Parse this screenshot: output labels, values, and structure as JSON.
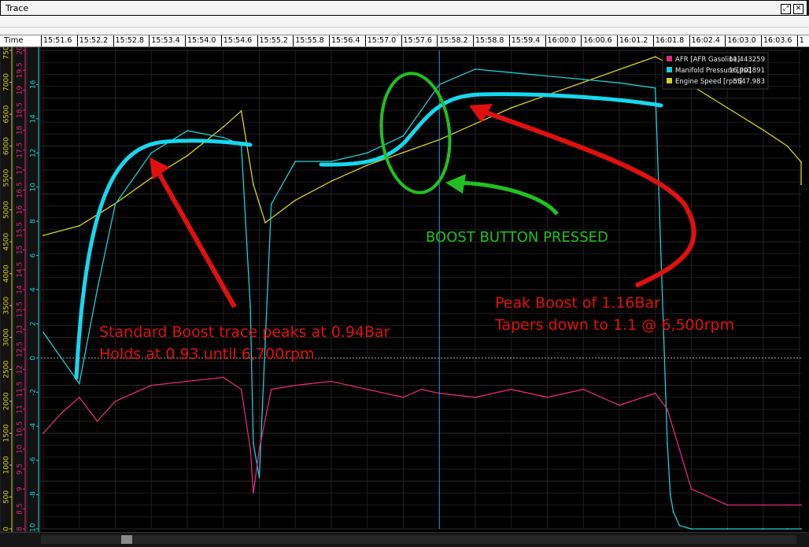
{
  "window": {
    "title": "Trace"
  },
  "time_axis": {
    "label": "Time",
    "ticks": [
      "15:51.6",
      "15:52.2",
      "15:52.8",
      "15:53.4",
      "15:54.0",
      "15:54.6",
      "15:55.2",
      "15:55.8",
      "15:56.4",
      "15:57.0",
      "15:57.6",
      "15:58.2",
      "15:58.8",
      "15:59.4",
      "16:00.0",
      "16:00.6",
      "16:01.2",
      "16:01.8",
      "16:02.4",
      "16:03.0",
      "16:03.6",
      "1"
    ]
  },
  "colors": {
    "afr": "#e0287a",
    "map": "#1ad0d8",
    "rpm": "#d8d01a",
    "cursor": "#2c8fe0",
    "annot_red": "#e01010",
    "annot_green": "#20c020",
    "annot_cyan": "#16d8ee"
  },
  "chart_data": {
    "type": "line",
    "x_range": [
      51.3,
      125.3
    ],
    "x_unit": "seconds past 15:51",
    "cursor_time": "15:58.2",
    "legend": [
      {
        "name": "AFR [AFR Gasoline]",
        "value": "11.443259",
        "color": "#e0287a"
      },
      {
        "name": "Manifold Pressure [psi]",
        "value": "16.901891",
        "color": "#1ad0d8"
      },
      {
        "name": "Engine Speed [rpm]",
        "value": "5547.983",
        "color": "#d8d01a"
      }
    ],
    "axes": [
      {
        "name": "Engine Speed",
        "unit": "rpm",
        "min": 0,
        "max": 7500,
        "ticks": [
          "7500",
          "7000",
          "6500",
          "6000",
          "5500",
          "5000",
          "4500",
          "4000",
          "3500",
          "3000",
          "2500",
          "2000",
          "1500",
          "1000",
          "500",
          "0"
        ]
      },
      {
        "name": "Manifold Pressure",
        "unit": "psi",
        "min": -10,
        "max": 18,
        "ticks": [
          "16",
          "14",
          "12",
          "10",
          "8",
          "6",
          "4",
          "2",
          "0",
          "-2",
          "-4",
          "-6",
          "-8",
          "-10"
        ]
      },
      {
        "name": "AFR",
        "unit": "AFR",
        "min": 8,
        "max": 20,
        "ticks": [
          "20",
          "19.5",
          "19",
          "18.5",
          "18",
          "17.5",
          "17",
          "16.5",
          "16",
          "15.5",
          "15",
          "14.5",
          "14",
          "13.5",
          "13",
          "12.5",
          "12",
          "11.5",
          "11",
          "10.5",
          "10",
          "9.5",
          "9",
          "8.5",
          "8"
        ]
      }
    ],
    "series": [
      {
        "name": "Engine Speed [rpm]",
        "x": [
          51.6,
          52.2,
          52.8,
          53.4,
          54.0,
          54.6,
          54.9,
          55.1,
          55.3,
          55.8,
          56.4,
          57.0,
          57.6,
          58.2,
          58.8,
          59.4,
          60.0,
          60.6,
          61.2,
          61.8,
          62.0,
          62.4,
          63.0,
          63.6,
          64.0,
          64.4,
          65.0
        ],
        "y": [
          4600,
          4750,
          5100,
          5500,
          5850,
          6300,
          6550,
          5400,
          4800,
          5150,
          5450,
          5700,
          5900,
          6100,
          6350,
          6600,
          6800,
          7000,
          7200,
          7400,
          7300,
          6950,
          6600,
          6250,
          6000,
          5750,
          5400
        ]
      },
      {
        "name": "Manifold Pressure [psi]",
        "x": [
          51.6,
          51.9,
          52.2,
          52.5,
          52.8,
          53.4,
          54.0,
          54.6,
          54.9,
          55.05,
          55.1,
          55.2,
          55.4,
          55.8,
          56.4,
          57.0,
          57.6,
          57.9,
          58.2,
          58.8,
          59.4,
          60.0,
          60.6,
          61.2,
          61.8,
          62.0,
          62.05,
          62.1,
          62.2,
          62.4,
          63.0,
          63.6,
          64.0,
          65.0
        ],
        "y": [
          1.5,
          0,
          -1.5,
          4,
          9,
          12,
          13.3,
          12.9,
          12.5,
          3,
          -5,
          -7,
          9,
          11.5,
          11.5,
          12,
          13,
          14.5,
          16,
          16.9,
          16.7,
          16.5,
          16.3,
          16.1,
          15.8,
          -5,
          -8,
          -9,
          -9.8,
          -10,
          -10,
          -10,
          -10,
          -10
        ]
      },
      {
        "name": "AFR [AFR Gasoline]",
        "x": [
          51.6,
          51.9,
          52.2,
          52.5,
          52.8,
          53.4,
          54.0,
          54.6,
          54.9,
          55.05,
          55.1,
          55.2,
          55.4,
          55.8,
          56.4,
          57.0,
          57.6,
          57.9,
          58.2,
          58.8,
          59.4,
          60.0,
          60.6,
          61.2,
          61.8,
          62.0,
          62.2,
          62.4,
          63.0,
          63.6,
          64.0,
          65.0
        ],
        "y": [
          10.4,
          10.9,
          11.3,
          10.7,
          11.2,
          11.6,
          11.7,
          11.8,
          11.5,
          10,
          8.9,
          10,
          11.5,
          11.6,
          11.7,
          11.5,
          11.3,
          11.5,
          11.4,
          11.3,
          11.5,
          11.3,
          11.5,
          11.1,
          11.4,
          11.0,
          10.0,
          9.0,
          8.6,
          8.6,
          8.6,
          8.6
        ]
      }
    ],
    "annotations": [
      {
        "text_lines": [
          "Standard Boost trace peaks at 0.94Bar",
          "Holds at 0.93 until 6,700rpm"
        ],
        "color": "#e01010"
      },
      {
        "text_lines": [
          "Peak Boost of 1.16Bar",
          "Tapers down to 1.1 @ 6,500rpm"
        ],
        "color": "#e01010"
      },
      {
        "text_lines": [
          "BOOST BUTTON PRESSED"
        ],
        "color": "#20c020"
      }
    ]
  }
}
